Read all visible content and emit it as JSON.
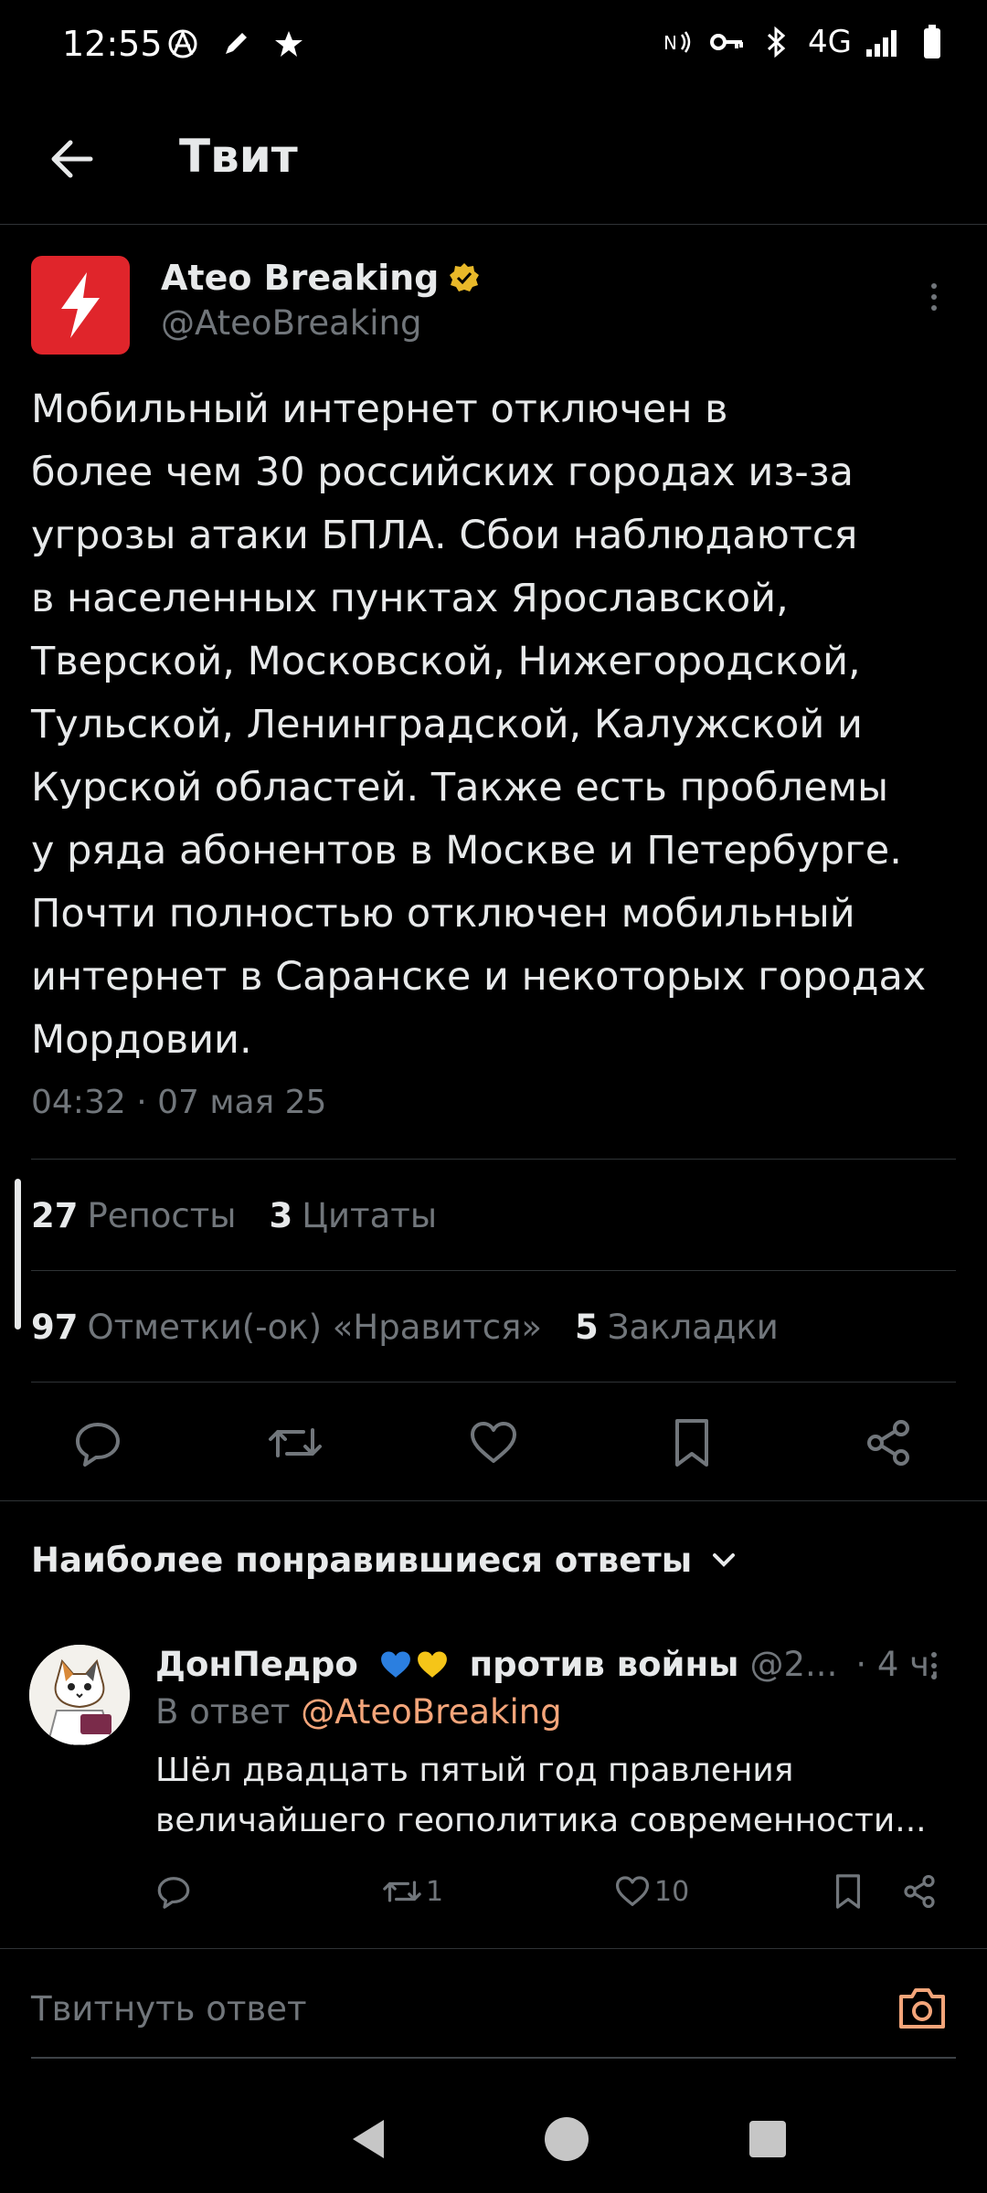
{
  "status_bar": {
    "time": "12:55",
    "network": "4G",
    "left_icons": [
      "anarchy-icon",
      "pencil-icon",
      "star-icon"
    ],
    "right_icons": [
      "nfc-icon",
      "key-icon",
      "bluetooth-icon",
      "signal-icon",
      "battery-icon"
    ]
  },
  "header": {
    "title": "Твит",
    "back_icon": "arrow-left-icon"
  },
  "tweet": {
    "author_name": "Ateo Breaking",
    "author_handle": "@AteoBreaking",
    "verified": true,
    "text": "Мобильный интернет отключен в\nболее чем 30 российских городах из-за\nугрозы атаки БПЛА. Сбои наблюдаются\nв населенных пунктах Ярославской,\nТверской, Московской, Нижегородской,\nТульской, Ленинградской, Калужской и\nКурской областей. Также есть проблемы\nу ряда абонентов в Москве и Петербурге.\nПочти полностью отключен мобильный\nинтернет в Саранске и некоторых городах\nМордовии.",
    "timestamp": "04:32 · 07 мая 25",
    "stats": {
      "reposts_count": "27",
      "reposts_label": "Репосты",
      "quotes_count": "3",
      "quotes_label": "Цитаты",
      "likes_count": "97",
      "likes_label": "Отметки(-ок) «Нравится»",
      "bookmarks_count": "5",
      "bookmarks_label": "Закладки"
    },
    "actions": [
      "reply-icon",
      "retweet-icon",
      "heart-icon",
      "bookmark-icon",
      "share-icon"
    ]
  },
  "replies_section": {
    "title": "Наиболее понравившиеся ответы"
  },
  "reply": {
    "name_prefix": "ДонПедро",
    "name_suffix": "против войны",
    "handle": "@2...",
    "age": "· 4 ч.",
    "reply_to_prefix": "В ответ",
    "reply_to_handle": "@AteoBreaking",
    "text": "Шёл двадцать пятый год правления величайшего геополитика современности...",
    "retweets": "1",
    "likes": "10"
  },
  "compose": {
    "placeholder": "Твитнуть ответ"
  },
  "colors": {
    "background": "#000000",
    "text": "#e7e9ea",
    "muted": "#71767b",
    "divider": "#2f3336",
    "brand_red": "#e0252b",
    "verified_gold": "#e8b829",
    "mention": "#f4a57a",
    "camera_accent": "#f4a57a"
  }
}
